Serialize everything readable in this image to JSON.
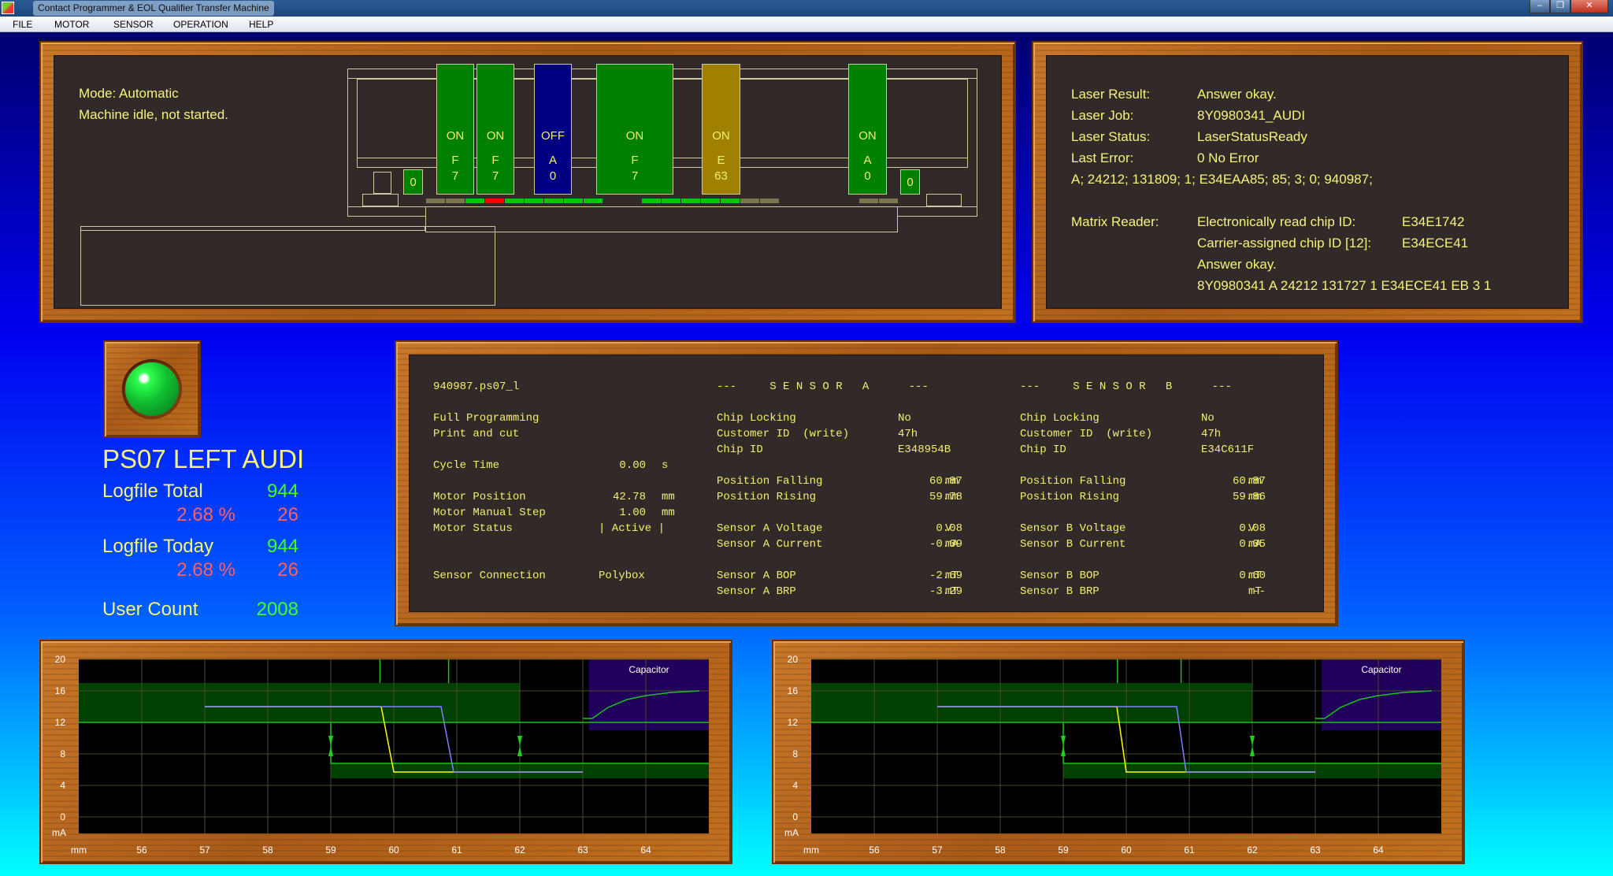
{
  "window": {
    "title": "Contact Programmer & EOL Qualifier Transfer Machine",
    "buttons": [
      "–",
      "❐",
      "✕"
    ]
  },
  "menu": [
    "FILE",
    "MOTOR",
    "SENSOR",
    "OPERATION",
    "HELP"
  ],
  "machine": {
    "mode": "Mode:  Automatic",
    "status": "Machine idle, not started.",
    "stations": [
      {
        "state": "ON",
        "letter": "F",
        "num": "7",
        "color": "#008000"
      },
      {
        "state": "ON",
        "letter": "F",
        "num": "7",
        "color": "#008000"
      },
      {
        "state": "OFF",
        "letter": "A",
        "num": "0",
        "color": "#000080"
      },
      {
        "state": "ON",
        "letter": "F",
        "num": "7",
        "color": "#008000"
      },
      {
        "state": "ON",
        "letter": "E",
        "num": "63",
        "color": "#a08000"
      },
      {
        "state": "ON",
        "letter": "A",
        "num": "0",
        "color": "#008000"
      }
    ],
    "end_left": "0",
    "end_right": "0",
    "strip_colors": {
      "gray": "#7a7650",
      "green": "#00c800",
      "red": "#ff0000"
    },
    "strip": [
      [
        "gray",
        "gray",
        "green",
        "red",
        "green",
        "green",
        "green",
        "green",
        "green"
      ],
      [
        "green",
        "green",
        "green",
        "green",
        "green",
        "gray",
        "gray"
      ],
      [
        "gray",
        "gray"
      ]
    ]
  },
  "laser": {
    "rows": [
      [
        "Laser Result:",
        "Answer okay."
      ],
      [
        "Laser Job:",
        "8Y0980341_AUDI"
      ],
      [
        "Laser Status:",
        "LaserStatusReady"
      ],
      [
        "Last Error:",
        "0  No Error"
      ]
    ],
    "data_line": "A;  24212;  131809;  1;  E34EAA85;  85;  3;  0;  940987;",
    "matrix_label": "Matrix Reader:",
    "matrix_rows": [
      [
        "Electronically read chip ID:",
        "E34E1742"
      ],
      [
        "Carrier-assigned chip ID [12]:",
        "E34ECE41"
      ]
    ],
    "matrix_answer": "Answer okay.",
    "matrix_line": "8Y0980341 A 24212 131727 1 E34ECE41 EB 3 1"
  },
  "station": {
    "led": "green",
    "led_color": "#10d030",
    "name": "PS07 LEFT AUDI",
    "logfile_total_label": "Logfile  Total",
    "logfile_total": "944",
    "total_pct": "2.68 %",
    "total_fail": "26",
    "logfile_today_label": "Logfile  Today",
    "logfile_today": "944",
    "today_pct": "2.68 %",
    "today_fail": "26",
    "user_count_label": "User  Count",
    "user_count": "2008"
  },
  "sensor_panel": {
    "file": "940987.ps07_l",
    "header_a": "---     S E N S O R   A      ---",
    "header_b": "---     S E N S O R   B      ---",
    "left": [
      [
        "Full Programming",
        "",
        ""
      ],
      [
        "Print and cut",
        "",
        ""
      ],
      [
        "Cycle Time",
        "0.00",
        "s"
      ],
      [
        "Motor Position",
        "42.78",
        "mm"
      ],
      [
        "Motor Manual Step",
        "1.00",
        "mm"
      ],
      [
        "Motor Status",
        "| Active |",
        ""
      ],
      [
        "Sensor Connection",
        "Polybox",
        ""
      ]
    ],
    "sensor_a": [
      [
        "Chip Locking",
        "No",
        ""
      ],
      [
        "Customer ID  (write)",
        "47h",
        ""
      ],
      [
        "Chip ID",
        "E348954B",
        ""
      ],
      [
        "Position Falling",
        "60.87",
        "mm"
      ],
      [
        "Position Rising",
        "59.78",
        "mm"
      ],
      [
        "Sensor A Voltage",
        "0.08",
        "V"
      ],
      [
        "Sensor A Current",
        "-0.09",
        "mA"
      ],
      [
        "Sensor A BOP",
        "-2.69",
        "mT"
      ],
      [
        "Sensor A BRP",
        "-3.29",
        "mT"
      ]
    ],
    "sensor_b": [
      [
        "Chip Locking",
        "No",
        ""
      ],
      [
        "Customer ID  (write)",
        "47h",
        ""
      ],
      [
        "Chip ID",
        "E34C611F",
        ""
      ],
      [
        "Position Falling",
        "60.87",
        "mm"
      ],
      [
        "Position Rising",
        "59.86",
        "mm"
      ],
      [
        "Sensor B Voltage",
        "0.08",
        "V"
      ],
      [
        "Sensor B Current",
        "0.05",
        "mA"
      ],
      [
        "Sensor B BOP",
        "0.60",
        "mT"
      ],
      [
        "Sensor B BRP",
        "--",
        "mT"
      ]
    ]
  },
  "chart_data": [
    {
      "type": "line",
      "xlabel": "mm",
      "ylabel": "mA",
      "xlim": [
        55,
        65
      ],
      "ylim": [
        0,
        20
      ],
      "xticks": [
        56,
        57,
        58,
        59,
        60,
        61,
        62,
        63,
        64
      ],
      "yticks": [
        0,
        4,
        8,
        12,
        16,
        20
      ],
      "grid": true,
      "series": [
        {
          "color": "#ffff00",
          "points": [
            [
              57,
              14.0
            ],
            [
              59.8,
              14.0
            ],
            [
              60.0,
              5.7
            ],
            [
              63,
              5.7
            ]
          ]
        },
        {
          "color": "#8080ff",
          "points": [
            [
              57,
              14.0
            ],
            [
              60.75,
              14.0
            ],
            [
              60.95,
              5.7
            ],
            [
              63,
              5.7
            ]
          ]
        }
      ],
      "bands": [
        {
          "x": [
            55,
            62
          ],
          "y": [
            12,
            17
          ]
        },
        {
          "x": [
            59,
            65
          ],
          "y": [
            4.9,
            6.8
          ]
        }
      ],
      "markers": [
        59.78,
        60.87
      ],
      "arrows": [
        59,
        62
      ],
      "inset": {
        "label": "Capacitor",
        "x": [
          63.1,
          65
        ],
        "y": [
          11,
          20
        ],
        "points": [
          [
            63,
            12.5
          ],
          [
            63.15,
            12.5
          ],
          [
            63.4,
            13.9
          ],
          [
            63.7,
            14.9
          ],
          [
            64,
            15.4
          ],
          [
            64.4,
            15.8
          ],
          [
            64.85,
            16
          ]
        ]
      }
    },
    {
      "type": "line",
      "xlabel": "mm",
      "ylabel": "mA",
      "xlim": [
        55,
        65
      ],
      "ylim": [
        0,
        20
      ],
      "xticks": [
        56,
        57,
        58,
        59,
        60,
        61,
        62,
        63,
        64
      ],
      "yticks": [
        0,
        4,
        8,
        12,
        16,
        20
      ],
      "grid": true,
      "series": [
        {
          "color": "#ffff00",
          "points": [
            [
              57,
              14.0
            ],
            [
              59.85,
              14.0
            ],
            [
              60.0,
              5.7
            ],
            [
              63,
              5.7
            ]
          ]
        },
        {
          "color": "#8080ff",
          "points": [
            [
              57,
              14.0
            ],
            [
              60.8,
              14.0
            ],
            [
              60.95,
              5.7
            ],
            [
              63,
              5.7
            ]
          ]
        }
      ],
      "bands": [
        {
          "x": [
            55,
            62
          ],
          "y": [
            12,
            17
          ]
        },
        {
          "x": [
            59,
            65
          ],
          "y": [
            4.9,
            6.8
          ]
        }
      ],
      "markers": [
        59.86,
        60.87
      ],
      "arrows": [
        59,
        62
      ],
      "inset": {
        "label": "Capacitor",
        "x": [
          63.1,
          65
        ],
        "y": [
          11,
          20
        ],
        "points": [
          [
            63,
            12.5
          ],
          [
            63.15,
            12.5
          ],
          [
            63.4,
            13.9
          ],
          [
            63.7,
            14.9
          ],
          [
            64,
            15.4
          ],
          [
            64.4,
            15.8
          ],
          [
            64.85,
            16
          ]
        ]
      }
    }
  ]
}
